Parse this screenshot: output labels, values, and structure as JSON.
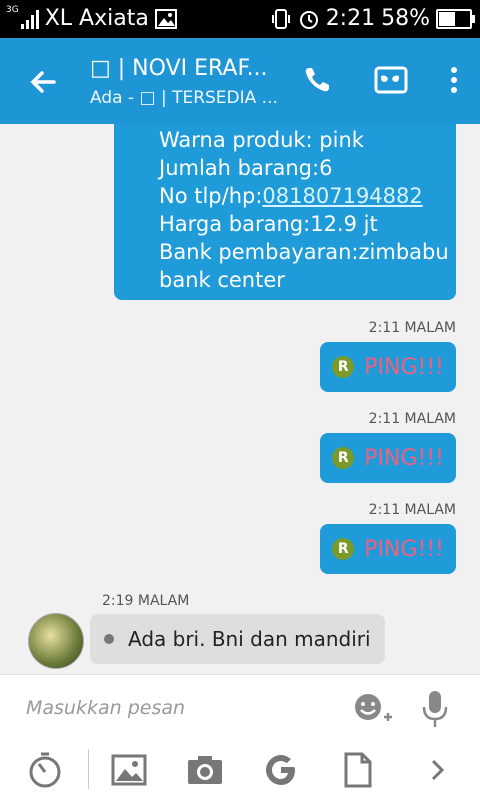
{
  "status": {
    "carrier": "XL Axiata",
    "network_type": "3G",
    "time": "2:21",
    "battery_percent": "58%",
    "battery_level": 0.58
  },
  "header": {
    "title": "□ | NOVI ERAF...",
    "subtitle": "Ada - □ | TERSEDIA ..."
  },
  "messages": {
    "big": {
      "lines": [
        "Warna produk: pink",
        "Jumlah barang:6",
        "No tlp/hp:",
        "Harga barang:12.9 jt",
        "Bank pembayaran:zimbabu",
        "bank center"
      ],
      "phone": "081807194882"
    },
    "pings": [
      {
        "time": "2:11 MALAM",
        "badge": "R",
        "text": "PING!!!"
      },
      {
        "time": "2:11 MALAM",
        "badge": "R",
        "text": "PING!!!"
      },
      {
        "time": "2:11 MALAM",
        "badge": "R",
        "text": "PING!!!"
      }
    ],
    "incoming": {
      "time": "2:19 MALAM",
      "text": "Ada bri. Bni dan mandiri"
    }
  },
  "compose": {
    "placeholder": "Masukkan pesan"
  },
  "icons": {
    "back": "arrow-left-icon",
    "call": "phone-icon",
    "video": "mask-icon",
    "more": "kebab-icon",
    "emoji": "emoji-add-icon",
    "mic": "mic-icon",
    "tools": [
      "stopwatch-icon",
      "image-icon",
      "camera-icon",
      "google-icon",
      "file-icon",
      "chevron-right-icon"
    ]
  },
  "colors": {
    "appbar": "#1e96d6",
    "bubble_out": "#1e9bd8",
    "ping_text": "#f06080",
    "bubble_in": "#dedede"
  }
}
